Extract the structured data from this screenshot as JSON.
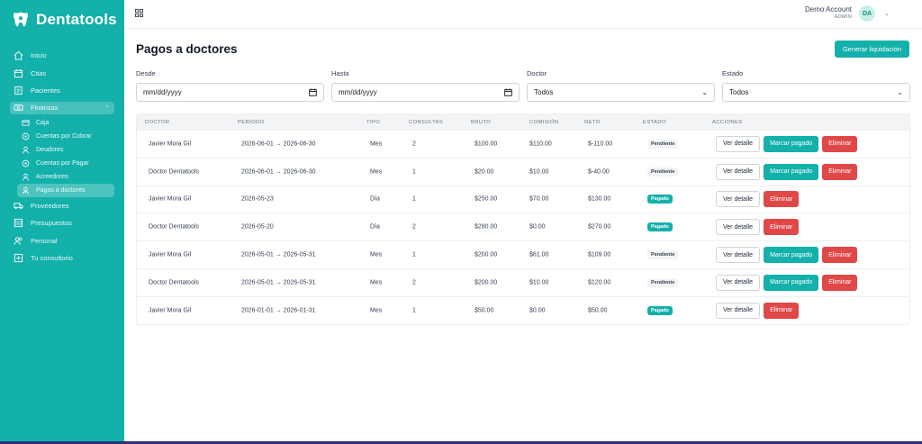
{
  "brand": {
    "name": "Dentatools"
  },
  "sidebar": {
    "items": [
      {
        "label": "Inicio",
        "icon": "home-icon"
      },
      {
        "label": "Citas",
        "icon": "calendar-icon"
      },
      {
        "label": "Pacientes",
        "icon": "patients-icon"
      },
      {
        "label": "Finanzas",
        "icon": "money-icon"
      },
      {
        "label": "Proveedores",
        "icon": "truck-icon"
      },
      {
        "label": "Presupuestos",
        "icon": "stack-icon"
      },
      {
        "label": "Personal",
        "icon": "users-icon"
      },
      {
        "label": "Tu consultorio",
        "icon": "clinic-icon"
      }
    ],
    "finanzas_sub": [
      {
        "label": "Caja",
        "icon": "cash-icon"
      },
      {
        "label": "Cuentas por Cobrar",
        "icon": "coin-icon"
      },
      {
        "label": "Deudores",
        "icon": "person-icon"
      },
      {
        "label": "Cuentas por Pagar",
        "icon": "coin-icon"
      },
      {
        "label": "Acreedores",
        "icon": "person-icon"
      },
      {
        "label": "Pagos a doctores",
        "icon": "doctor-icon"
      }
    ]
  },
  "header": {
    "account_name": "Demo Account",
    "account_role": "ADMIN",
    "avatar_initials": "DA"
  },
  "page": {
    "title": "Pagos a doctores",
    "action_label": "Generar liquidación"
  },
  "filters": {
    "desde": {
      "label": "Desde",
      "value": "mm/dd/yyyy"
    },
    "hasta": {
      "label": "Hasta",
      "value": "mm/dd/yyyy"
    },
    "doctor": {
      "label": "Doctor",
      "value": "Todos"
    },
    "estado": {
      "label": "Estado",
      "value": "Todos"
    }
  },
  "table": {
    "headers": [
      "DOCTOR",
      "PERÍODO",
      "TIPO",
      "CONSULTAS",
      "BRUTO",
      "COMISIÓN",
      "NETO",
      "ESTADO",
      "ACCIONES"
    ],
    "actions": {
      "view": "Ver detalle",
      "mark": "Marcar pagado",
      "delete": "Eliminar"
    },
    "rows": [
      {
        "doctor": "Javier Mora Gil",
        "periodo": "2026-06-01 → 2026-06-30",
        "tipo": "Mes",
        "consultas": "2",
        "bruto": "$100.00",
        "comision": "$110.00",
        "neto": "$-110.00",
        "estado": "Pendiente"
      },
      {
        "doctor": "Doctor Dentatools",
        "periodo": "2026-06-01 → 2026-06-30",
        "tipo": "Mes",
        "consultas": "1",
        "bruto": "$20.00",
        "comision": "$10.00",
        "neto": "$-40.00",
        "estado": "Pendiente"
      },
      {
        "doctor": "Javier Mora Gil",
        "periodo": "2026-05-23",
        "tipo": "Día",
        "consultas": "1",
        "bruto": "$250.00",
        "comision": "$70.00",
        "neto": "$130.00",
        "estado": "Pagado"
      },
      {
        "doctor": "Doctor Dentatools",
        "periodo": "2026-05-20",
        "tipo": "Día",
        "consultas": "2",
        "bruto": "$280.00",
        "comision": "$0.00",
        "neto": "$270.00",
        "estado": "Pagado"
      },
      {
        "doctor": "Javier Mora Gil",
        "periodo": "2026-05-01 → 2026-05-31",
        "tipo": "Mes",
        "consultas": "1",
        "bruto": "$200.00",
        "comision": "$61.00",
        "neto": "$109.00",
        "estado": "Pendiente"
      },
      {
        "doctor": "Doctor Dentatools",
        "periodo": "2026-05-01 → 2026-05-31",
        "tipo": "Mes",
        "consultas": "2",
        "bruto": "$200.00",
        "comision": "$10.00",
        "neto": "$120.00",
        "estado": "Pendiente"
      },
      {
        "doctor": "Javier Mora Gil",
        "periodo": "2026-01-01 → 2026-01-31",
        "tipo": "Mes",
        "consultas": "1",
        "bruto": "$50.00",
        "comision": "$0.00",
        "neto": "$50.00",
        "estado": "Pagado"
      }
    ]
  },
  "colors": {
    "teal": "#14b0aa",
    "red": "#e04848"
  }
}
